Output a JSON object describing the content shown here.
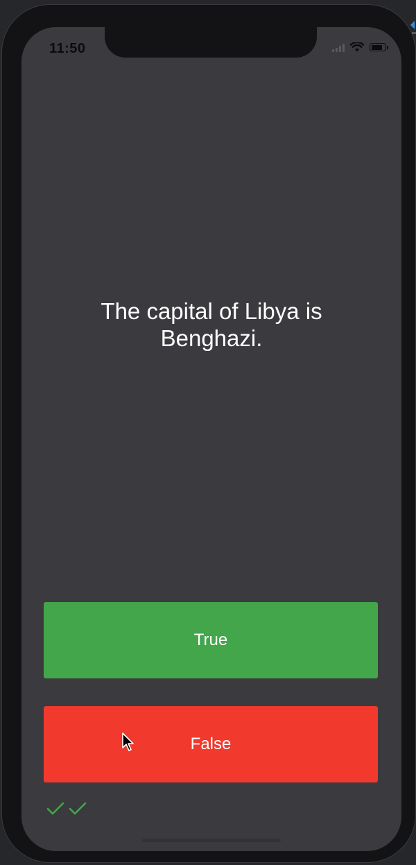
{
  "status_bar": {
    "time": "11:50"
  },
  "quiz": {
    "question": "The capital of Libya is Benghazi."
  },
  "buttons": {
    "true_label": "True",
    "false_label": "False"
  },
  "score": {
    "icons": [
      "check-icon",
      "check-icon"
    ]
  },
  "colors": {
    "background": "#3b3a3e",
    "true_button": "#43a64b",
    "false_button": "#f2392d",
    "check_mark": "#43a64b"
  }
}
